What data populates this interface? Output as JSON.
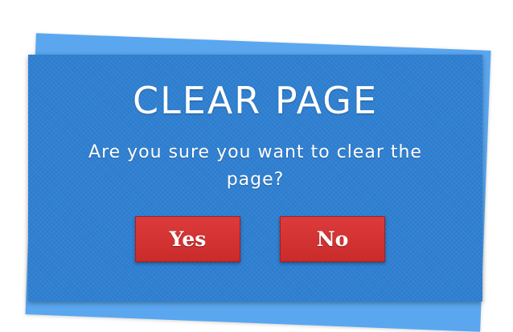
{
  "dialog": {
    "title": "CLEAR PAGE",
    "message": "Are you sure you want to clear the page?",
    "yes_label": "Yes",
    "no_label": "No"
  },
  "colors": {
    "dialog_background": "#2f80d2",
    "back_card": "#5aa7f0",
    "button": "#d63333",
    "text": "#ffffff"
  }
}
